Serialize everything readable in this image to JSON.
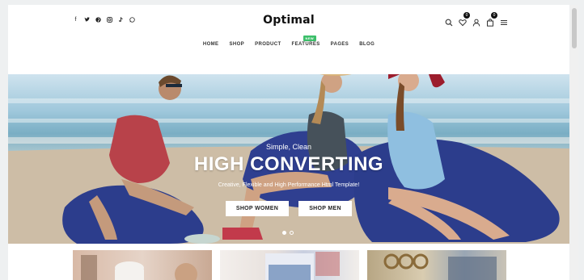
{
  "site": {
    "logo": "Optimal"
  },
  "social_icons": [
    "facebook-icon",
    "twitter-icon",
    "pinterest-icon",
    "instagram-icon",
    "tiktok-icon",
    "whatsapp-icon"
  ],
  "utility": {
    "wishlist_count": "0",
    "cart_count": "0"
  },
  "nav": {
    "items": [
      "HOME",
      "SHOP",
      "PRODUCT",
      "FEATURES",
      "PAGES",
      "BLOG"
    ],
    "new_badge": "NEW"
  },
  "hero": {
    "kicker": "Simple, Clean",
    "title": "HIGH CONVERTING",
    "subtitle": "Creative, Flexible and High Performance Html Template!",
    "btn_women": "SHOP WOMEN",
    "btn_men": "SHOP MEN",
    "slide_count": 2,
    "active_slide": 1
  },
  "colors": {
    "accent_new_badge": "#3cbf6a",
    "text_dark": "#111111",
    "hero_button_bg": "#ffffff"
  }
}
